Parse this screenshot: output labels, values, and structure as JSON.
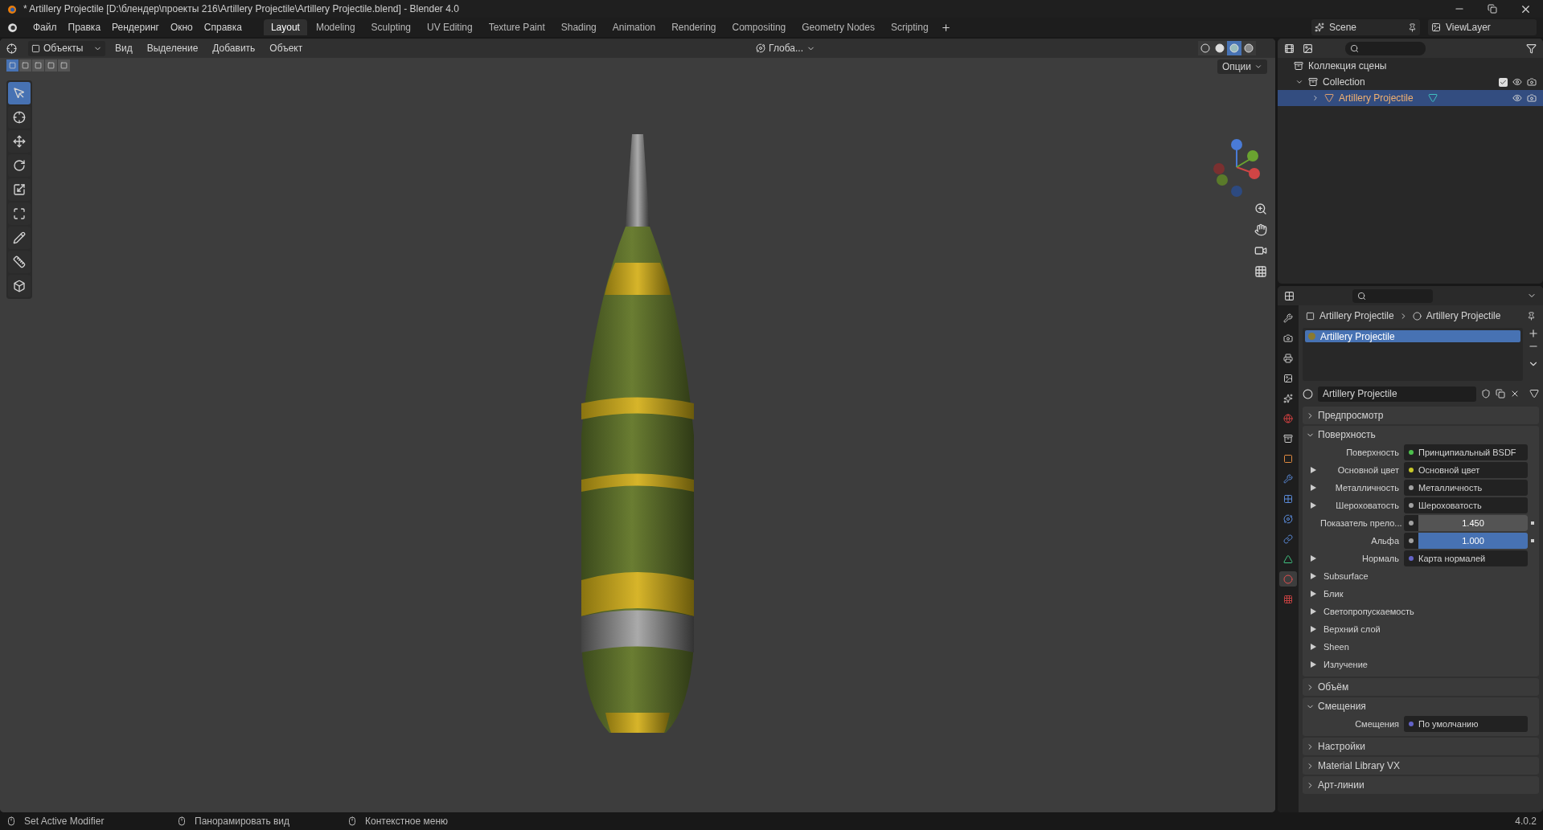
{
  "window": {
    "title": "* Artillery Projectile [D:\\блендер\\проекты 216\\Artillery Projectile\\Artillery Projectile.blend] - Blender 4.0"
  },
  "menu": [
    "Файл",
    "Правка",
    "Рендеринг",
    "Окно",
    "Справка"
  ],
  "workspaces": [
    {
      "label": "Layout",
      "selected": true
    },
    {
      "label": "Modeling",
      "selected": false
    },
    {
      "label": "Sculpting",
      "selected": false
    },
    {
      "label": "UV Editing",
      "selected": false
    },
    {
      "label": "Texture Paint",
      "selected": false
    },
    {
      "label": "Shading",
      "selected": false
    },
    {
      "label": "Animation",
      "selected": false
    },
    {
      "label": "Rendering",
      "selected": false
    },
    {
      "label": "Compositing",
      "selected": false
    },
    {
      "label": "Geometry Nodes",
      "selected": false
    },
    {
      "label": "Scripting",
      "selected": false
    }
  ],
  "scene": "Scene",
  "view_layer": "ViewLayer",
  "viewport": {
    "mode": "Объекты",
    "menus": [
      "Вид",
      "Выделение",
      "Добавить",
      "Объект"
    ],
    "orientation": "Глоба...",
    "options": "Опции",
    "select_modes": [
      {
        "selected": true
      },
      {
        "selected": false
      },
      {
        "selected": false
      },
      {
        "selected": false
      },
      {
        "selected": false
      }
    ],
    "shading": [
      {
        "kind": "wireframe",
        "selected": false
      },
      {
        "kind": "solid",
        "selected": false
      },
      {
        "kind": "material",
        "selected": true
      },
      {
        "kind": "rendered",
        "selected": false
      }
    ],
    "tools": [
      {
        "kind": "select",
        "selected": true
      },
      {
        "kind": "cursor",
        "selected": false
      },
      {
        "kind": "move",
        "selected": false
      },
      {
        "kind": "rotate",
        "selected": false
      },
      {
        "kind": "scale",
        "selected": false
      },
      {
        "kind": "transform",
        "selected": false
      },
      {
        "kind": "annotate",
        "selected": false
      },
      {
        "kind": "measure",
        "selected": false
      },
      {
        "kind": "add-cube",
        "selected": false
      }
    ]
  },
  "outliner": {
    "title": "Коллекция сцены",
    "collections": [
      {
        "label": "Collection",
        "expanded": true,
        "checked": true,
        "objects": [
          {
            "label": "Artillery Projectile",
            "selected": true,
            "expanded": false
          }
        ]
      }
    ]
  },
  "properties": {
    "breadcrumb": [
      "Artillery Projectile",
      "Artillery Projectile"
    ],
    "tabs": [
      {
        "kind": "tool",
        "selected": false
      },
      {
        "kind": "render",
        "selected": false
      },
      {
        "kind": "output",
        "selected": false
      },
      {
        "kind": "view-layer",
        "selected": false
      },
      {
        "kind": "scene",
        "selected": false
      },
      {
        "kind": "world",
        "selected": false
      },
      {
        "kind": "collection",
        "selected": false
      },
      {
        "kind": "object",
        "selected": false
      },
      {
        "kind": "modifiers",
        "selected": false
      },
      {
        "kind": "particles",
        "selected": false
      },
      {
        "kind": "physics",
        "selected": false
      },
      {
        "kind": "constraints",
        "selected": false
      },
      {
        "kind": "data",
        "selected": false
      },
      {
        "kind": "material",
        "selected": true
      },
      {
        "kind": "texture",
        "selected": false
      }
    ],
    "slots": [
      {
        "name": "Artillery Projectile",
        "selected": true
      }
    ],
    "material": "Artillery Projectile",
    "panels": [
      {
        "title": "Предпросмотр",
        "expanded": false
      },
      {
        "title": "Поверхность",
        "expanded": true,
        "rows": [
          {
            "kind": "link",
            "label": "Поверхность",
            "value": "Принципиальный BSDF",
            "color": "#4cc04c",
            "expandable": false
          },
          {
            "kind": "link",
            "label": "Основной цвет",
            "value": "Основной цвет",
            "color": "#c7c729",
            "expandable": true
          },
          {
            "kind": "link",
            "label": "Металличность",
            "value": "Металличность",
            "color": "#a1a1a1",
            "expandable": true
          },
          {
            "kind": "link",
            "label": "Шероховатость",
            "value": "Шероховатость",
            "color": "#a1a1a1",
            "expandable": true
          },
          {
            "kind": "number",
            "label": "Показатель прело...",
            "value": "1.450",
            "color": "#a1a1a1",
            "expandable": false
          },
          {
            "kind": "slider",
            "label": "Альфа",
            "value": "1.000",
            "level": 1,
            "color": "#a1a1a1",
            "expandable": false
          },
          {
            "kind": "link",
            "label": "Нормаль",
            "value": "Карта нормалей",
            "color": "#6363c7",
            "expandable": true
          },
          {
            "kind": "group",
            "label": "Subsurface"
          },
          {
            "kind": "group",
            "label": "Блик"
          },
          {
            "kind": "group",
            "label": "Светопропускаемость"
          },
          {
            "kind": "group",
            "label": "Верхний слой"
          },
          {
            "kind": "group",
            "label": "Sheen"
          },
          {
            "kind": "group",
            "label": "Излучение"
          }
        ]
      },
      {
        "title": "Объём",
        "expanded": false
      },
      {
        "title": "Смещения",
        "expanded": true,
        "rows": [
          {
            "kind": "link",
            "label": "Смещения",
            "value": "По умолчанию",
            "color": "#6363c7",
            "expandable": false
          }
        ]
      },
      {
        "title": "Настройки",
        "expanded": false
      },
      {
        "title": "Material Library VX",
        "expanded": false
      },
      {
        "title": "Арт-линии",
        "expanded": false
      }
    ]
  },
  "status_bar": {
    "items": [
      "Set Active Modifier",
      "Панорамировать вид",
      "Контекстное меню"
    ],
    "version": "4.0.2"
  }
}
